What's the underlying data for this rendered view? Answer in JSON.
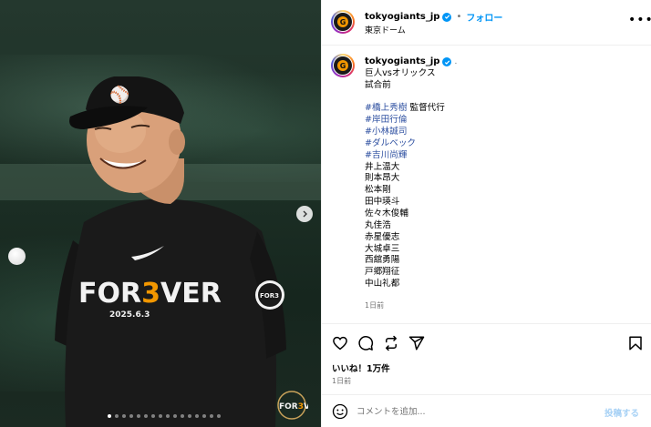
{
  "account": {
    "username": "tokyogiants_jp",
    "location": "東京ドーム",
    "follow_label": "フォロー",
    "separator": "•",
    "more_label": "•••",
    "avatar_icon": "giants-logo-icon"
  },
  "caption": {
    "username": "tokyogiants_jp",
    "dot": ".",
    "lines": [
      {
        "text": "巨人vsオリックス",
        "type": "text"
      },
      {
        "text": "試合前",
        "type": "text"
      },
      {
        "text": "",
        "type": "spacer"
      },
      {
        "hashtag": "#橋上秀樹",
        "text": " 監督代行",
        "type": "mixed"
      },
      {
        "text": "#岸田行倫",
        "type": "hashtag"
      },
      {
        "text": "#小林誠司",
        "type": "hashtag"
      },
      {
        "text": "#ダルベック",
        "type": "hashtag"
      },
      {
        "text": "#吉川尚輝",
        "type": "hashtag"
      },
      {
        "text": "井上温大",
        "type": "text"
      },
      {
        "text": "則本昂大",
        "type": "text"
      },
      {
        "text": "松本剛",
        "type": "text"
      },
      {
        "text": "田中瑛斗",
        "type": "text"
      },
      {
        "text": "佐々木俊輔",
        "type": "text"
      },
      {
        "text": "丸佳浩",
        "type": "text"
      },
      {
        "text": "赤星優志",
        "type": "text"
      },
      {
        "text": "大城卓三",
        "type": "text"
      },
      {
        "text": "西舘勇陽",
        "type": "text"
      },
      {
        "text": "戸郷翔征",
        "type": "text"
      },
      {
        "text": "中山礼都",
        "type": "text"
      }
    ],
    "time": "1日前"
  },
  "media": {
    "shirt_text": "FOR3VER",
    "shirt_date": "2025.6.3",
    "patch_text": "FOR3VER",
    "carousel_count": 16,
    "carousel_active": 0
  },
  "engagement": {
    "likes": "いいね！1万件",
    "date": "1日前",
    "icons": [
      "heart-icon",
      "comment-icon",
      "repost-icon",
      "share-icon",
      "bookmark-icon"
    ]
  },
  "comment_box": {
    "placeholder": "コメントを追加...",
    "post_label": "投稿する"
  },
  "colors": {
    "accent": "#0095f6",
    "hashtag": "#2d4fa0",
    "muted": "#737373",
    "giants_orange": "#f29700"
  }
}
